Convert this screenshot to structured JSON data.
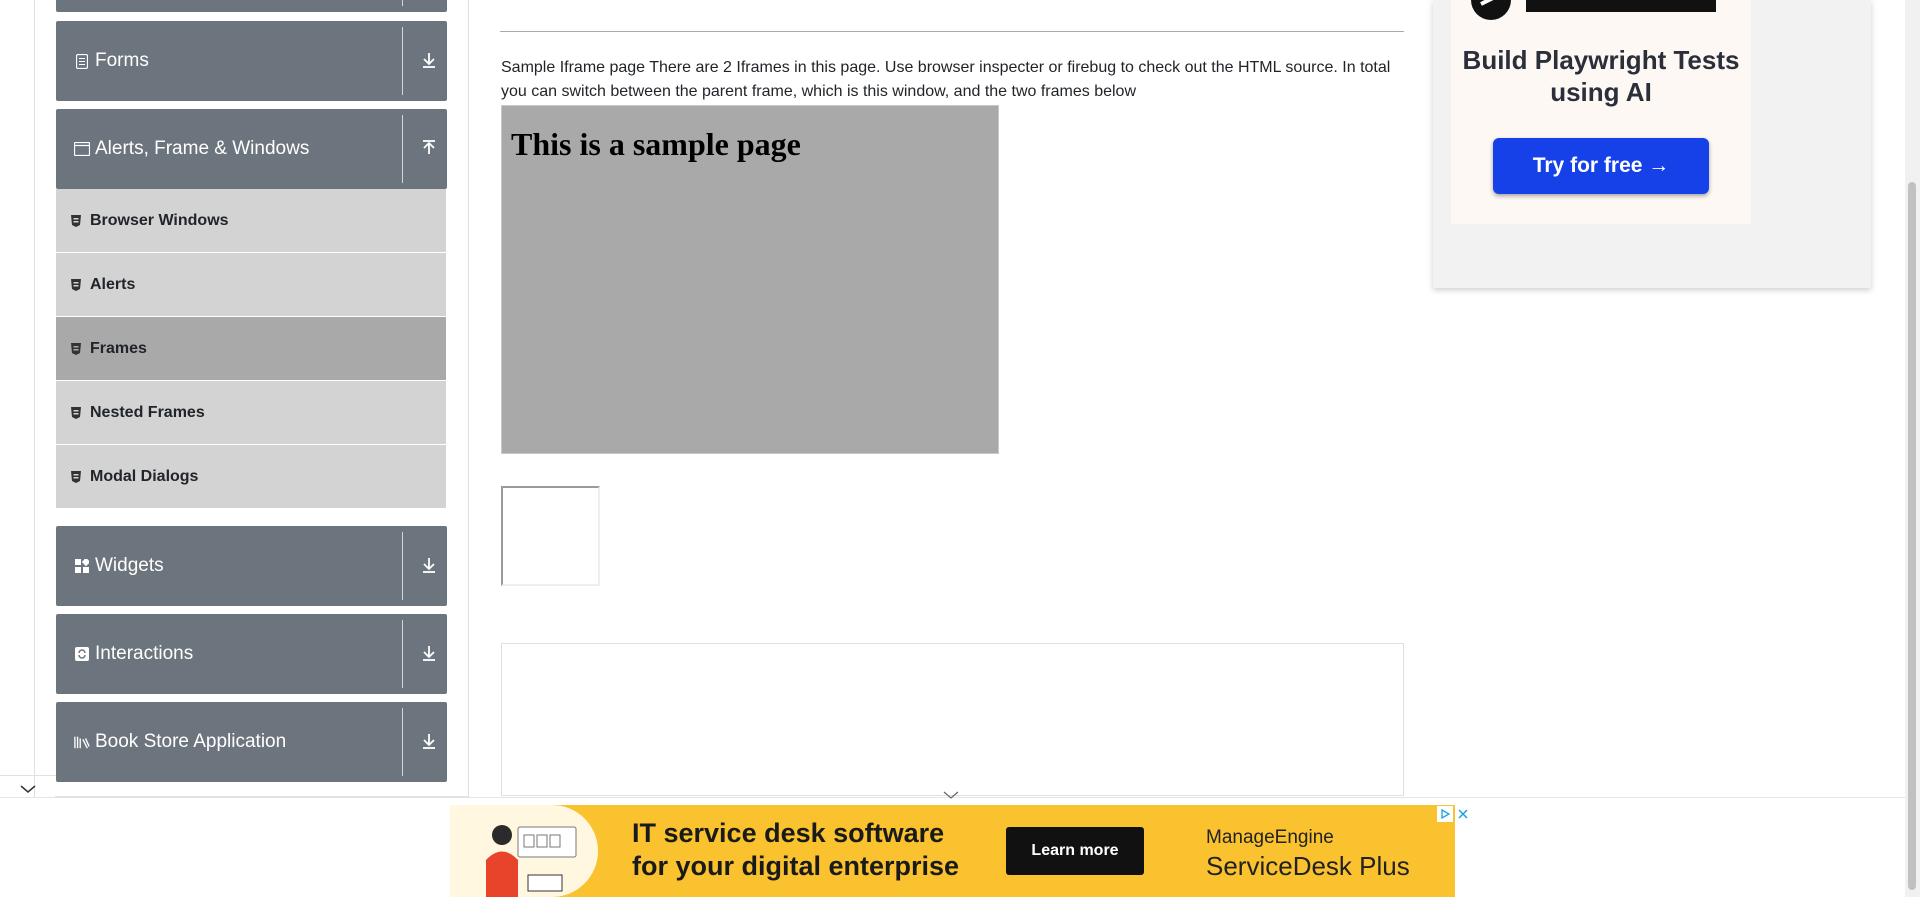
{
  "sidebar": {
    "groups": [
      {
        "label": "Forms",
        "icon": "form-icon",
        "expanded": false
      },
      {
        "label": "Alerts, Frame & Windows",
        "icon": "window-icon",
        "expanded": true
      },
      {
        "label": "Widgets",
        "icon": "widgets-icon",
        "expanded": false
      },
      {
        "label": "Interactions",
        "icon": "interactions-icon",
        "expanded": false
      },
      {
        "label": "Book Store Application",
        "icon": "books-icon",
        "expanded": false
      }
    ],
    "items": [
      {
        "label": "Browser Windows",
        "active": false
      },
      {
        "label": "Alerts",
        "active": false
      },
      {
        "label": "Frames",
        "active": true
      },
      {
        "label": "Nested Frames",
        "active": false
      },
      {
        "label": "Modal Dialogs",
        "active": false
      }
    ]
  },
  "main": {
    "description": "Sample Iframe page There are 2 Iframes in this page. Use browser inspecter or firebug to check out the HTML source. In total you can switch between the parent frame, which is this window, and the two frames below",
    "frame1_heading": "This is a sample page"
  },
  "right_ad": {
    "headline": "Build Playwright Tests using AI",
    "cta": "Try for free →"
  },
  "bottom_ad": {
    "line1": "IT service desk software",
    "line2": "for your digital enterprise",
    "cta": "Learn more",
    "brand": "ManageEngine",
    "product": "ServiceDesk Plus"
  },
  "colors": {
    "group_bg": "#6c757d",
    "item_bg": "#d3d3d3",
    "item_active_bg": "#a9a9a9",
    "ad_yellow": "#f9c22e",
    "cta_blue": "#1640e8"
  }
}
